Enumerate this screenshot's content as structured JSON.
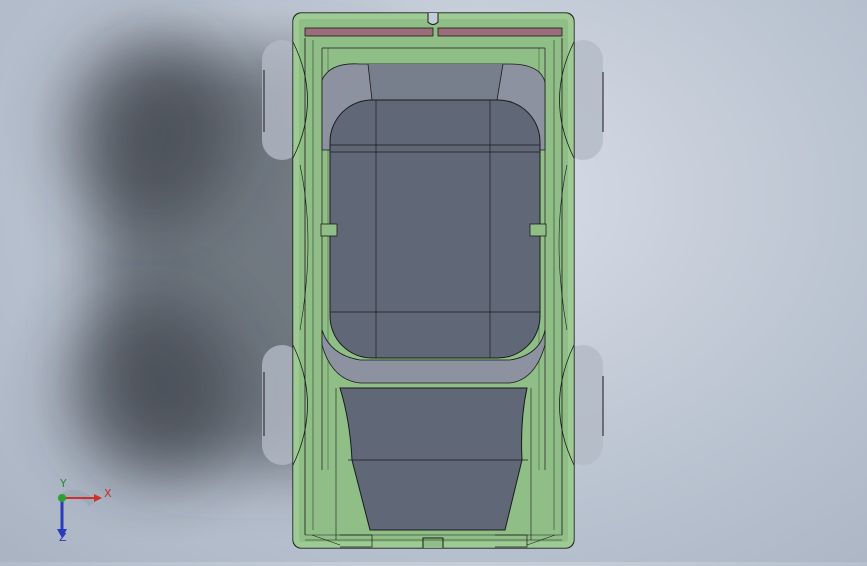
{
  "viewport": {
    "background_color": "#c5ccd8",
    "model_color": "#8fbf86",
    "edge_color": "#1a1a1a",
    "glass_color": "#606878",
    "trim_color": "#9a6e79"
  },
  "triad": {
    "x_label": "X",
    "y_label": "Y",
    "z_label": "Z",
    "x_color": "#d0302a",
    "y_color": "#2ea02e",
    "z_color": "#2a3ac0"
  }
}
